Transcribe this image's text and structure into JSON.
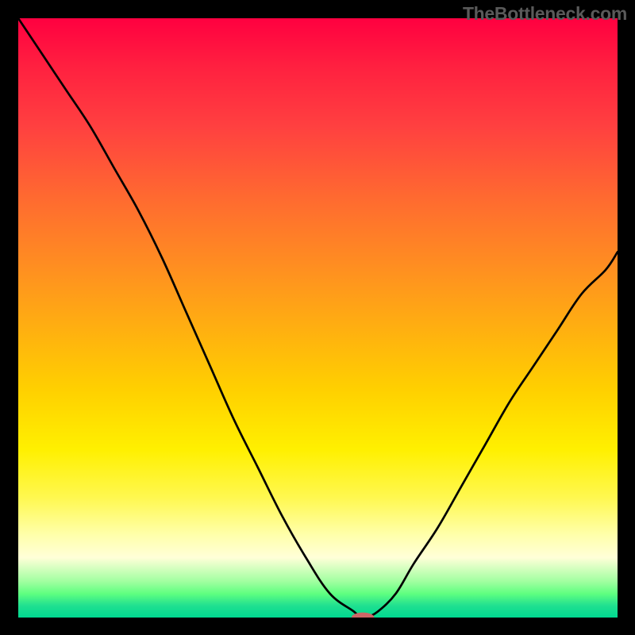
{
  "source_label": "TheBottleneck.com",
  "chart_data": {
    "type": "line",
    "title": "",
    "xlabel": "",
    "ylabel": "",
    "xlim": [
      0,
      100
    ],
    "ylim": [
      0,
      100
    ],
    "series": [
      {
        "name": "bottleneck-curve",
        "x": [
          0,
          4,
          8,
          12,
          16,
          20,
          24,
          28,
          32,
          36,
          40,
          44,
          48,
          52,
          56,
          57,
          58,
          60,
          63,
          66,
          70,
          74,
          78,
          82,
          86,
          90,
          94,
          98,
          100
        ],
        "y": [
          100,
          94,
          88,
          82,
          75,
          68,
          60,
          51,
          42,
          33,
          25,
          17,
          10,
          4,
          1,
          0,
          0,
          1,
          4,
          9,
          15,
          22,
          29,
          36,
          42,
          48,
          54,
          58,
          61
        ]
      }
    ],
    "marker": {
      "x": 57.5,
      "y": 0,
      "rx": 1.9,
      "ry": 0.85,
      "color": "#cc6666"
    }
  }
}
